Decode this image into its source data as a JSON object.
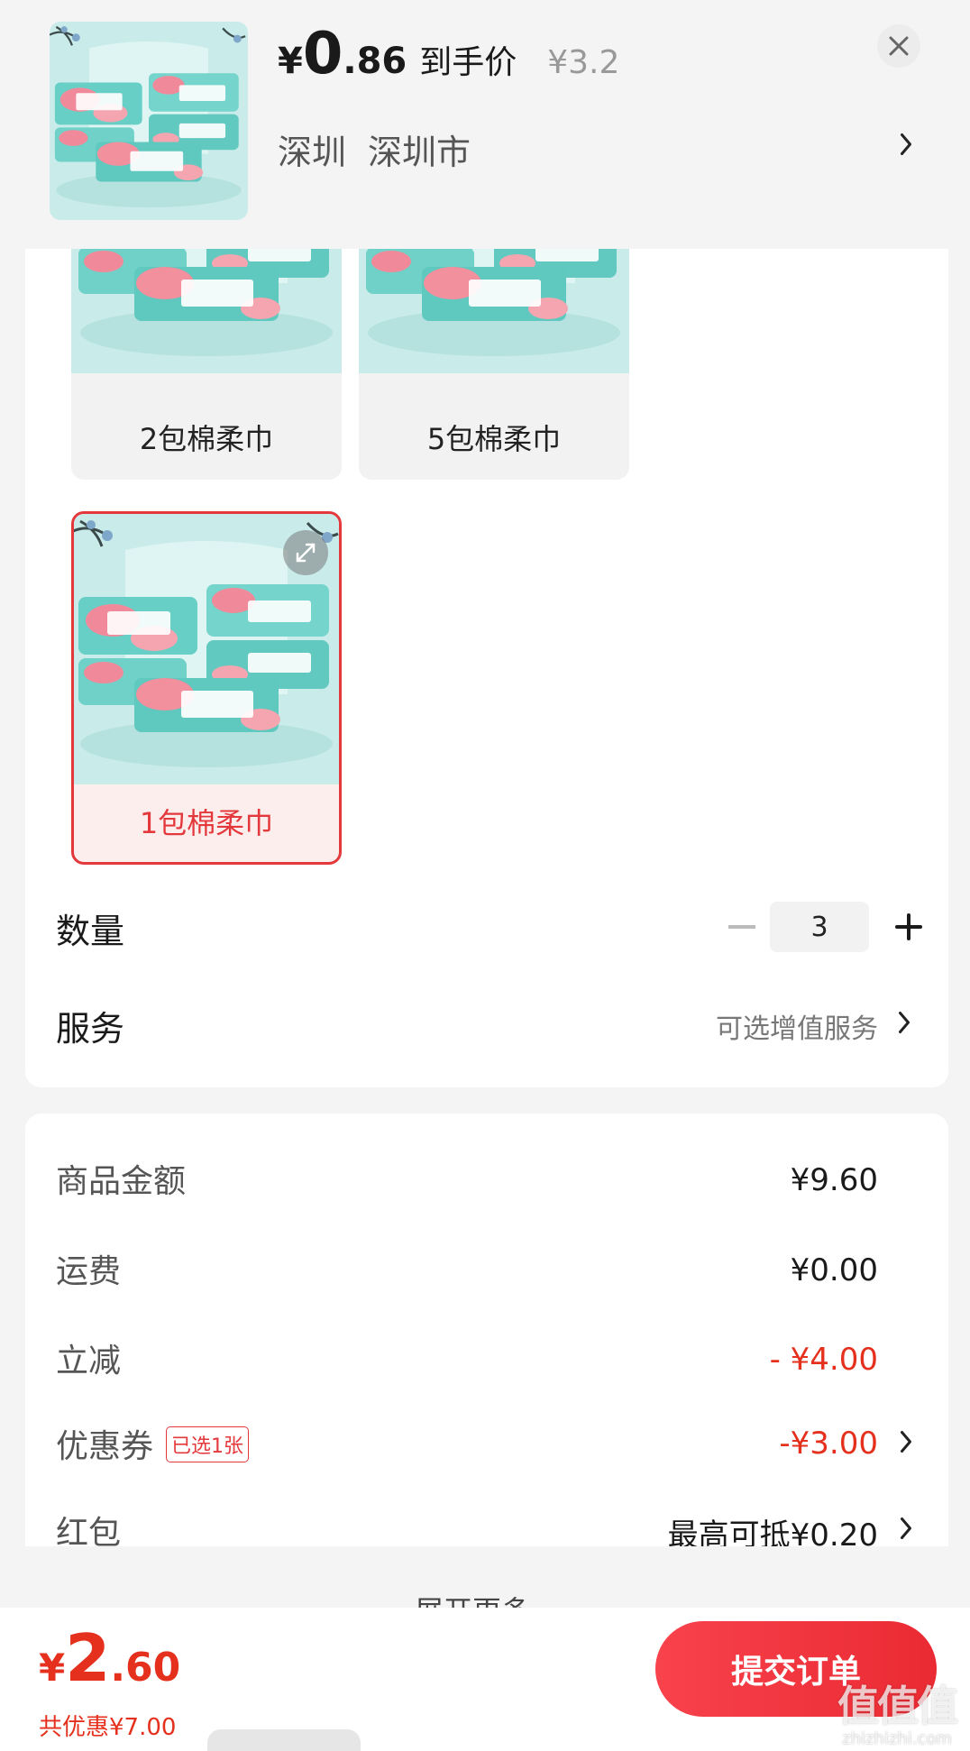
{
  "header": {
    "currency_symbol": "¥",
    "price_integer": "0",
    "price_decimal": ".86",
    "price_label": "到手价",
    "original_price": "¥3.2",
    "address_city": "深圳",
    "address_district": "深圳市"
  },
  "sku_options": [
    {
      "label": "2包棉柔巾",
      "selected": false
    },
    {
      "label": "5包棉柔巾",
      "selected": false
    },
    {
      "label": "1包棉柔巾",
      "selected": true
    }
  ],
  "quantity": {
    "label": "数量",
    "value": "3"
  },
  "service": {
    "label": "服务",
    "hint": "可选增值服务"
  },
  "fees": {
    "goods_amount_label": "商品金额",
    "goods_amount": "¥9.60",
    "shipping_label": "运费",
    "shipping": "¥0.00",
    "discount_label": "立减",
    "discount": "- ¥4.00",
    "coupon_label": "优惠券",
    "coupon_tag": "已选1张",
    "coupon_value": "-¥3.00",
    "red_packet_label": "红包",
    "red_packet_value": "最高可抵¥0.20",
    "expand_more": "展开更多"
  },
  "footer": {
    "currency_symbol": "¥",
    "total_integer": "2",
    "total_decimal": ".60",
    "savings": "共优惠¥7.00",
    "submit_label": "提交订单"
  },
  "watermark": {
    "mark": "值值值",
    "url": "zhizhizhi.com"
  },
  "colors": {
    "accent_red": "#e4301c",
    "button_red": "#f03a42",
    "background": "#f4f4f4"
  },
  "icons": [
    "close-icon",
    "chevron-right-icon",
    "minus-icon",
    "plus-icon",
    "zoom-icon"
  ]
}
